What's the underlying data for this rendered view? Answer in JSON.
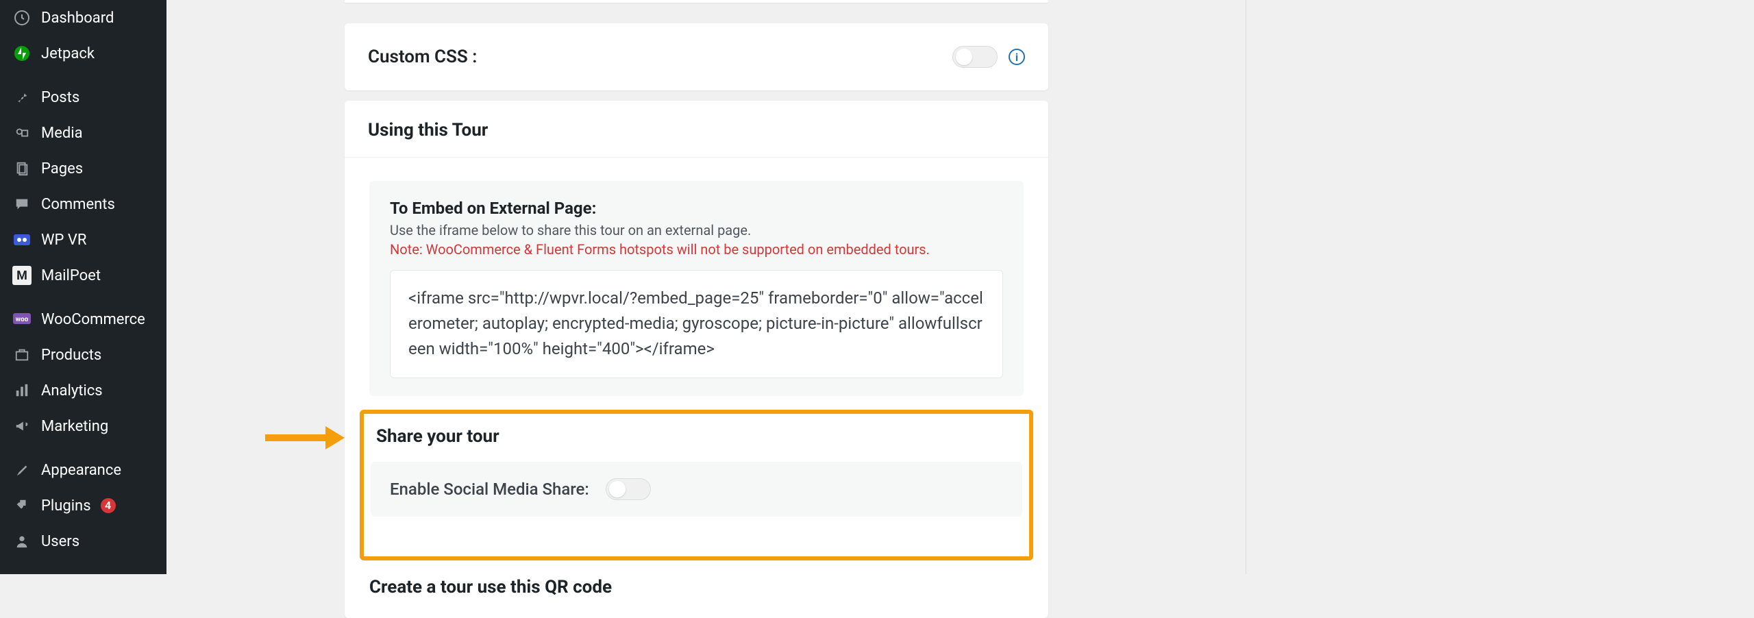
{
  "sidebar": {
    "items": [
      {
        "label": "Dashboard",
        "icon": "dashboard"
      },
      {
        "label": "Jetpack",
        "icon": "jetpack"
      },
      {
        "label": "Posts",
        "icon": "pin"
      },
      {
        "label": "Media",
        "icon": "media"
      },
      {
        "label": "Pages",
        "icon": "pages"
      },
      {
        "label": "Comments",
        "icon": "comment"
      },
      {
        "label": "WP VR",
        "icon": "vr"
      },
      {
        "label": "MailPoet",
        "icon": "mailpoet"
      },
      {
        "label": "WooCommerce",
        "icon": "woo"
      },
      {
        "label": "Products",
        "icon": "products"
      },
      {
        "label": "Analytics",
        "icon": "analytics"
      },
      {
        "label": "Marketing",
        "icon": "megaphone"
      },
      {
        "label": "Appearance",
        "icon": "brush"
      },
      {
        "label": "Plugins",
        "icon": "plugin",
        "badge": "4"
      },
      {
        "label": "Users",
        "icon": "user"
      }
    ]
  },
  "customCss": {
    "label": "Custom CSS :"
  },
  "usingTour": {
    "heading": "Using this Tour",
    "embed": {
      "title": "To Embed on External Page:",
      "help": "Use the iframe below to share this tour on an external page.",
      "note": "Note: WooCommerce & Fluent Forms hotspots will not be supported on embedded tours.",
      "code": "<iframe src=\"http://wpvr.local/?embed_page=25\" frameborder=\"0\" allow=\"accelerometer; autoplay; encrypted-media; gyroscope; picture-in-picture\" allowfullscreen width=\"100%\" height=\"400\"></iframe>"
    },
    "share": {
      "heading": "Share your tour",
      "enable_label": "Enable Social Media Share:"
    },
    "qr": {
      "heading": "Create a tour use this QR code"
    }
  }
}
